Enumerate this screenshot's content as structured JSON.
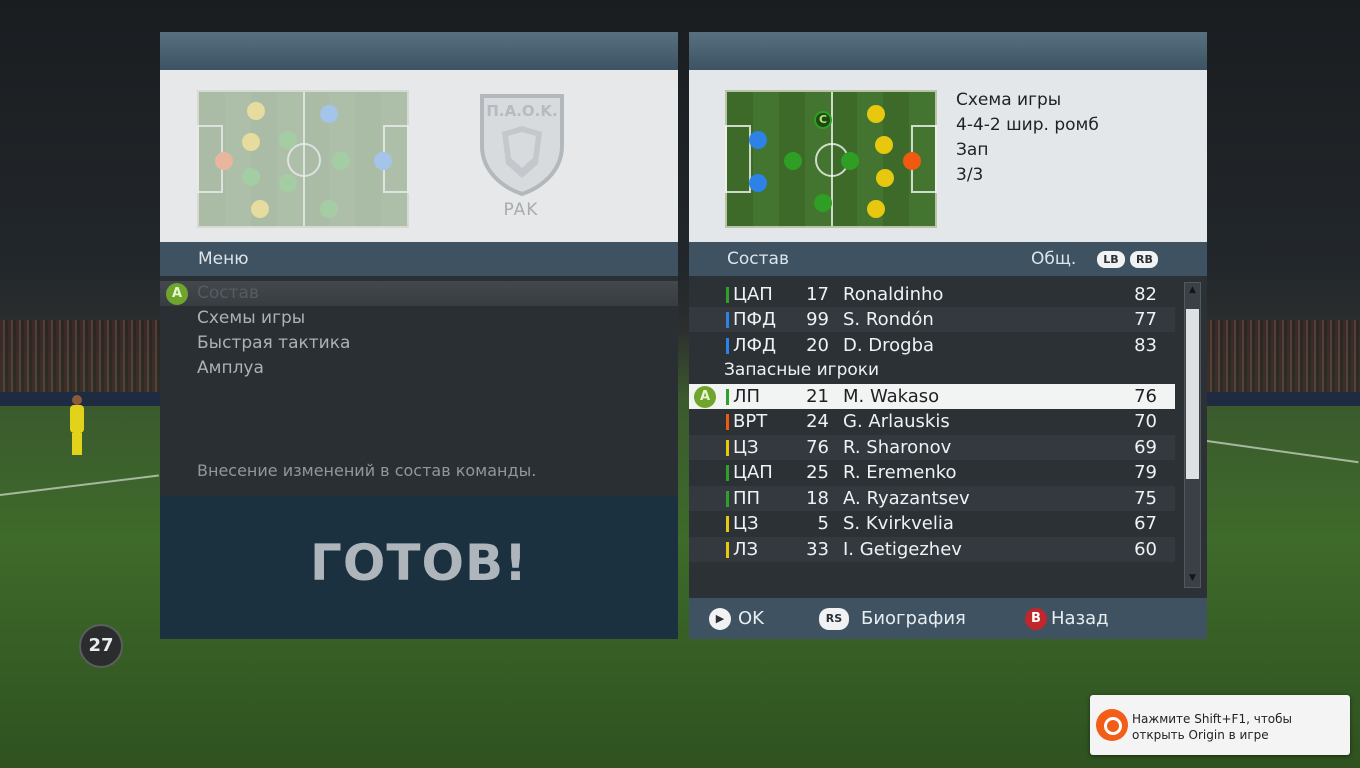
{
  "left_panel": {
    "team_code": "PAK",
    "crest_text": "П.Α.Ο.Κ.",
    "menu_header": "Меню",
    "menu_items": [
      {
        "label": "Состав"
      },
      {
        "label": "Схемы игры"
      },
      {
        "label": "Быстрая тактика"
      },
      {
        "label": "Амплуа"
      }
    ],
    "selected_button": "A",
    "description": "Внесение изменений в состав команды.",
    "ready_label": "ГОТОВ!"
  },
  "right_panel": {
    "formation_title": "Схема игры",
    "formation_name": "4-4-2 шир. ромб",
    "tactic": "Зап",
    "page": "3/3",
    "captain_marker": "C",
    "roster_header": "Состав",
    "overall_header": "Общ.",
    "lb_label": "LB",
    "rb_label": "RB",
    "players": [
      {
        "pos": "ЦАП",
        "num": "17",
        "name": "Ronaldinho",
        "ovr": "82",
        "color": "#2fa12a"
      },
      {
        "pos": "ПФД",
        "num": "99",
        "name": "S. Rondón",
        "ovr": "77",
        "color": "#2d82e8"
      },
      {
        "pos": "ЛФД",
        "num": "20",
        "name": "D. Drogba",
        "ovr": "83",
        "color": "#2d82e8"
      }
    ],
    "subs_label": "Запасные игроки",
    "subs": [
      {
        "pos": "ЛП",
        "num": "21",
        "name": "M. Wakaso",
        "ovr": "76",
        "color": "#2fa12a"
      },
      {
        "pos": "ВРТ",
        "num": "24",
        "name": "G. Arlauskis",
        "ovr": "70",
        "color": "#ef5a10"
      },
      {
        "pos": "ЦЗ",
        "num": "76",
        "name": "R. Sharonov",
        "ovr": "69",
        "color": "#e8c80f"
      },
      {
        "pos": "ЦАП",
        "num": "25",
        "name": "R. Eremenko",
        "ovr": "79",
        "color": "#2fa12a"
      },
      {
        "pos": "ПП",
        "num": "18",
        "name": "A. Ryazantsev",
        "ovr": "75",
        "color": "#2fa12a"
      },
      {
        "pos": "ЦЗ",
        "num": "5",
        "name": "S. Kvirkvelia",
        "ovr": "67",
        "color": "#e8c80f"
      },
      {
        "pos": "ЛЗ",
        "num": "33",
        "name": "I. Getigezhev",
        "ovr": "60",
        "color": "#e8c80f"
      }
    ],
    "selected_sub_button": "A",
    "footer": {
      "ok_label": "OK",
      "rs_label": "RS",
      "bio_label": "Биография",
      "b_button": "B",
      "back_label": "Назад"
    }
  },
  "counter": "27",
  "origin_toast": "Нажмите Shift+F1, чтобы открыть Origin в игре",
  "colors": {
    "forward": "#2d82e8",
    "midfield": "#2fa12a",
    "defence": "#e8c80f",
    "keeper": "#ef5a10"
  }
}
